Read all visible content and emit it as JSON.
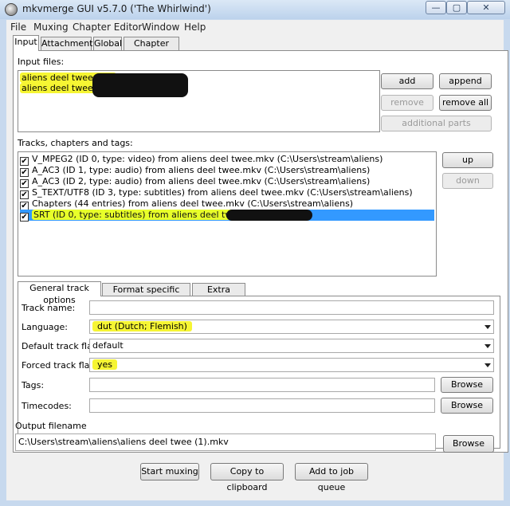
{
  "window": {
    "title": "mkvmerge GUI v5.7.0 ('The Whirlwind')",
    "controls": {
      "minimize": "—",
      "maximize": "▢",
      "close": "✕"
    }
  },
  "menu": [
    "File",
    "Muxing",
    "Chapter Editor",
    "Window",
    "Help"
  ],
  "tabs": [
    "Input",
    "Attachments",
    "Global",
    "Chapter Editor"
  ],
  "input_files": {
    "label": "Input files:",
    "files": [
      "aliens deel twee.mkv",
      "aliens deel twee.srt ("
    ]
  },
  "file_buttons": {
    "add": "add",
    "append": "append",
    "remove": "remove",
    "remove_all": "remove all",
    "additional_parts": "additional parts"
  },
  "tracks": {
    "label": "Tracks, chapters and tags:",
    "items": [
      "V_MPEG2 (ID 0, type: video) from aliens deel twee.mkv (C:\\Users\\stream\\aliens)",
      "A_AC3 (ID 1, type: audio) from aliens deel twee.mkv (C:\\Users\\stream\\aliens)",
      "A_AC3 (ID 2, type: audio) from aliens deel twee.mkv (C:\\Users\\stream\\aliens)",
      "S_TEXT/UTF8 (ID 3, type: subtitles) from aliens deel twee.mkv (C:\\Users\\stream\\aliens)",
      "Chapters (44 entries) from aliens deel twee.mkv (C:\\Users\\stream\\aliens)",
      "SRT (ID 0, type: subtitles) from aliens deel twee.srt ("
    ],
    "check_mark": "✔",
    "up": "up",
    "down": "down"
  },
  "track_tabs": [
    "General track options",
    "Format specific options",
    "Extra options"
  ],
  "general": {
    "track_name_label": "Track name:",
    "track_name_value": "",
    "language_label": "Language:",
    "language_value": "dut (Dutch; Flemish)",
    "default_flag_label": "Default track flag:",
    "default_flag_value": "default",
    "forced_flag_label": "Forced track flag:",
    "forced_flag_value": "yes",
    "tags_label": "Tags:",
    "tags_value": "",
    "timecodes_label": "Timecodes:",
    "timecodes_value": "",
    "browse": "Browse"
  },
  "output": {
    "label": "Output filename",
    "value": "C:\\Users\\stream\\aliens\\aliens deel twee (1).mkv",
    "browse": "Browse"
  },
  "actions": {
    "start": "Start muxing",
    "copy": "Copy to clipboard",
    "queue": "Add to job queue"
  },
  "colors": {
    "highlight": "#f6f533",
    "selection": "#3399ff",
    "redaction": "#111111"
  }
}
